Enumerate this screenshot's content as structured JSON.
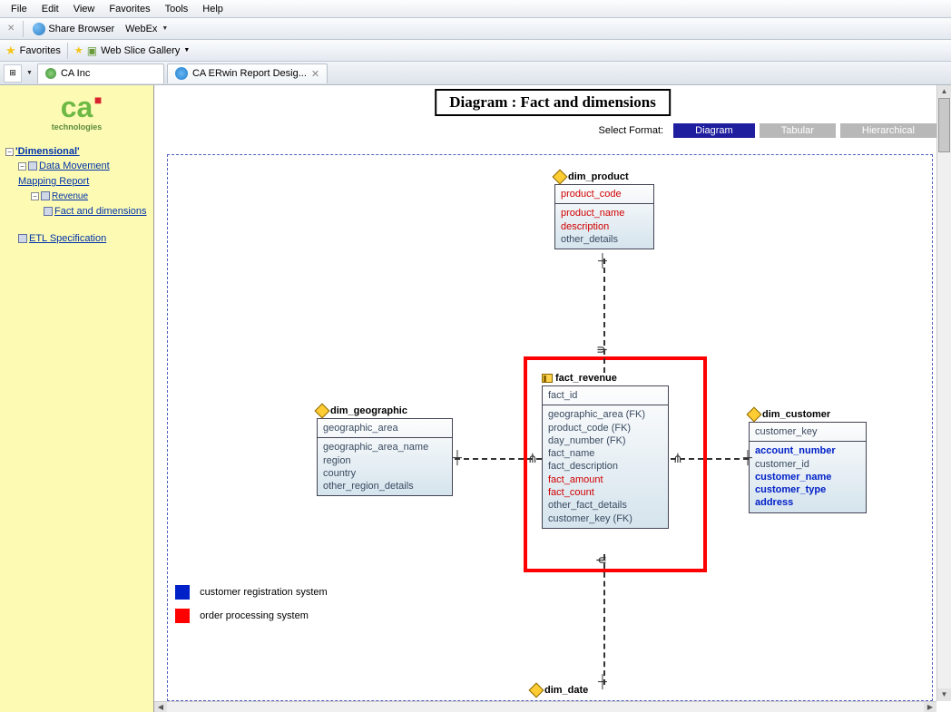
{
  "menu": [
    "File",
    "Edit",
    "View",
    "Favorites",
    "Tools",
    "Help"
  ],
  "tb1": {
    "share": "Share Browser",
    "webex": "WebEx"
  },
  "tb2": {
    "fav": "Favorites",
    "gallery": "Web Slice Gallery"
  },
  "tabs": {
    "t1": "CA Inc",
    "t2": "CA ERwin Report Desig..."
  },
  "logo_sub": "technologies",
  "tree": {
    "root": "'Dimensional'",
    "dm": "Data Movement Mapping Report",
    "rev": "Revenue",
    "fact": "Fact and dimensions",
    "etl": "ETL Specification"
  },
  "heading": "Diagram : Fact and dimensions",
  "format_label": "Select Format:",
  "fmt": {
    "diagram": "Diagram",
    "tabular": "Tabular",
    "hier": "Hierarchical"
  },
  "entities": {
    "dim_product": {
      "title": "dim_product",
      "pk": [
        "product_code"
      ],
      "cols": [
        {
          "t": "product_name",
          "c": "red"
        },
        {
          "t": "description",
          "c": "red"
        },
        {
          "t": "other_details",
          "c": "gray"
        }
      ]
    },
    "dim_geographic": {
      "title": "dim_geographic",
      "pk": [
        "geographic_area"
      ],
      "cols": [
        {
          "t": "geographic_area_name",
          "c": "gray"
        },
        {
          "t": "region",
          "c": "gray"
        },
        {
          "t": "country",
          "c": "gray"
        },
        {
          "t": "other_region_details",
          "c": "gray"
        }
      ]
    },
    "fact_revenue": {
      "title": "fact_revenue",
      "pk": [
        "fact_id"
      ],
      "cols": [
        {
          "t": "geographic_area (FK)",
          "c": "gray"
        },
        {
          "t": "product_code (FK)",
          "c": "gray"
        },
        {
          "t": "day_number (FK)",
          "c": "gray"
        },
        {
          "t": "fact_name",
          "c": "gray"
        },
        {
          "t": "fact_description",
          "c": "gray"
        },
        {
          "t": "fact_amount",
          "c": "red"
        },
        {
          "t": "fact_count",
          "c": "red"
        },
        {
          "t": "other_fact_details",
          "c": "gray"
        },
        {
          "t": "customer_key (FK)",
          "c": "gray"
        }
      ]
    },
    "dim_customer": {
      "title": "dim_customer",
      "pk": [
        "customer_key"
      ],
      "cols": [
        {
          "t": "account_number",
          "c": "blue"
        },
        {
          "t": "customer_id",
          "c": "gray"
        },
        {
          "t": "customer_name",
          "c": "blue"
        },
        {
          "t": "customer_type",
          "c": "blue"
        },
        {
          "t": "address",
          "c": "blue"
        }
      ]
    },
    "dim_date": {
      "title": "dim_date"
    }
  },
  "legend": {
    "blue": "customer registration system",
    "red": "order processing system"
  }
}
